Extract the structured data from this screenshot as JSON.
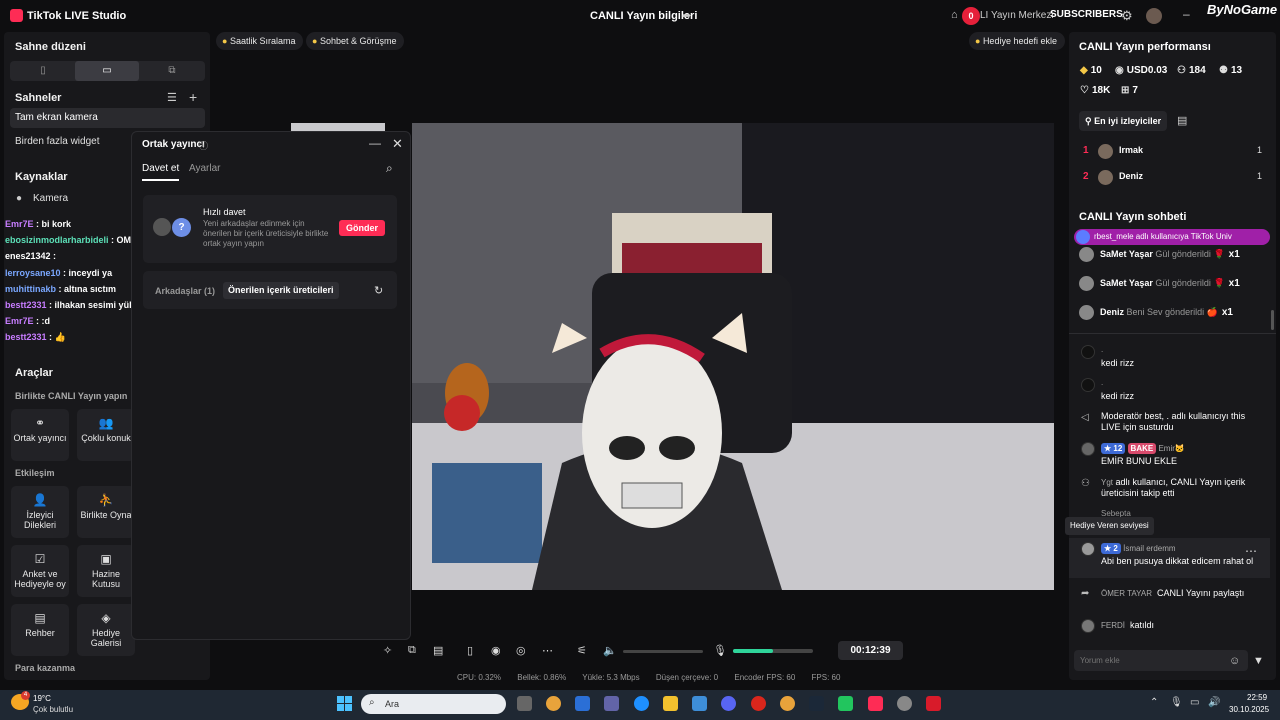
{
  "titlebar": {
    "app_title": "TikTok LIVE Studio",
    "live_info": "CANLI Yayın bilgileri",
    "badge_count": "0",
    "creator_center": "LI Yayın Merkezi",
    "subscribers": "SUBSCRIBERS",
    "watermark": "ByNoGame"
  },
  "left": {
    "scene_layout_title": "Sahne düzeni",
    "layout_options": [
      "▯",
      "▭",
      "⧉"
    ],
    "scenes_title": "Sahneler",
    "scenes": [
      "Tam ekran kamera",
      "Birden fazla widget"
    ],
    "sources_title": "Kaynaklar",
    "source_camera": "Kamera",
    "tools_title": "Araçlar",
    "tools_together": "Birlikte CANLI Yayın yapın",
    "interaction_title": "Etkileşim",
    "money_title": "Para kazanma",
    "tools": [
      {
        "icon": "⚭",
        "label": "Ortak yayıncı"
      },
      {
        "icon": "👥",
        "label": "Çoklu konuk"
      },
      {
        "icon": "👤",
        "label": "İzleyici Dilekleri"
      },
      {
        "icon": "⛹",
        "label": "Birlikte Oyna"
      },
      {
        "icon": "☑",
        "label": "Anket ve Hediyeyle oy"
      },
      {
        "icon": "▣",
        "label": "Hazine Kutusu"
      },
      {
        "icon": "▤",
        "label": "Rehber"
      },
      {
        "icon": "◈",
        "label": "Hediye Galerisi"
      }
    ]
  },
  "overlay_chat": [
    {
      "user": "Emr7E",
      "text": " : bi kork",
      "color": "#c77dff"
    },
    {
      "user": "ebosizinmodlarharbideli",
      "text": " : OME VARMI",
      "color": "#5ce0b8"
    },
    {
      "user": "enes21342",
      "text": " : ",
      "color": "#ffffff"
    },
    {
      "user": "lerroysane10",
      "text": " : inceydi ya",
      "color": "#7aa7ff"
    },
    {
      "user": "muhittinakb",
      "text": " : altına sıctım",
      "color": "#7aa7ff"
    },
    {
      "user": "bestt2331",
      "text": " : ilhakan sesimi yükselt",
      "color": "#c77dff"
    },
    {
      "user": "Emr7E",
      "text": " : :d",
      "color": "#c77dff"
    },
    {
      "user": "bestt2331",
      "text": " : 👍",
      "color": "#c77dff"
    }
  ],
  "pills": {
    "hourly_ranking": "Saatlik Sıralama",
    "chat_and_meet": "Sohbet & Görüşme",
    "gift_goal": "Hediye hedefi ekle"
  },
  "dialog": {
    "title": "Ortak yayıncı",
    "tab_invite": "Davet et",
    "tab_settings": "Ayarlar",
    "quick_invite_title": "Hızlı davet",
    "quick_invite_desc": "Yeni arkadaşlar edinmek için önerilen bir içerik üreticisiyle birlikte ortak yayın yapın",
    "send_button": "Gönder",
    "tab_friends": "Arkadaşlar (1)",
    "tab_suggested": "Önerilen içerik üreticileri",
    "avatar_placeholder": "?"
  },
  "controls": {
    "timer": "00:12:39",
    "mic_level": 0.5
  },
  "statusbar": {
    "cpu": "CPU: 0.32%",
    "memory": "Bellek: 0.86%",
    "upload": "Yükle: 5.3 Mbps",
    "dropped": "Düşen çerçeve: 0",
    "encoder_fps": "Encoder FPS: 60",
    "fps": "FPS: 60"
  },
  "right": {
    "perf_title": "CANLI Yayın performansı",
    "stats": {
      "diamonds": "10",
      "usd": "USD0.03",
      "viewers": "184",
      "new_followers": "13",
      "likes": "18K",
      "gifters": "7"
    },
    "top_viewers_label": "En iyi izleyiciler",
    "top_viewers": [
      {
        "rank": "1",
        "name": "Irmak",
        "score": "1"
      },
      {
        "rank": "2",
        "name": "Deniz",
        "score": "1"
      }
    ],
    "chat_title": "CANLI Yayın sohbeti",
    "banner": "rbest_mele adlı kullanıcıya TikTok Univ",
    "gifts": [
      {
        "name": "SaMet Yaşar",
        "text": "Gül gönderildi",
        "count": "x1",
        "icon": "🌹"
      },
      {
        "name": "SaMet Yaşar",
        "text": "Gül gönderildi",
        "count": "x1",
        "icon": "🌹"
      },
      {
        "name": "Deniz",
        "text": "Beni Sev gönderildi",
        "count": "x1",
        "icon": "🍎"
      }
    ],
    "comments": {
      "c1_user": ".",
      "c1_text": "kedi rizz",
      "c2_user": ".",
      "c2_text": "kedi rizz",
      "mod_text": "Moderatör best, . adlı kullanıcıyı this LIVE için susturdu",
      "c3_level": "12",
      "c3_badge": "BAKE",
      "c3_user": "Emir🐱",
      "c3_text": "EMİR BUNU EKLE",
      "follow_user": "Ygt",
      "follow_text": "adlı kullanıcı, CANLI Yayın içerik üreticisini takip etti",
      "peek_user": "Sebepta",
      "tooltip": "Hediye Veren seviyesi",
      "c4_level": "2",
      "c4_user": "İsmail erdemm",
      "c4_text": "Abi ben pusuya dikkat edicem rahat ol",
      "share_user": "ÖMER TAYAR",
      "share_text": "CANLI Yayını paylaştı",
      "join_user": "FERDİ",
      "join_text": "katıldı"
    },
    "comment_placeholder": "Yorum ekle"
  },
  "taskbar": {
    "temp": "19°C",
    "weather": "Çok bulutlu",
    "weather_badge": "4",
    "search": "Ara",
    "time": "22:59",
    "date": "30.10.2025"
  }
}
